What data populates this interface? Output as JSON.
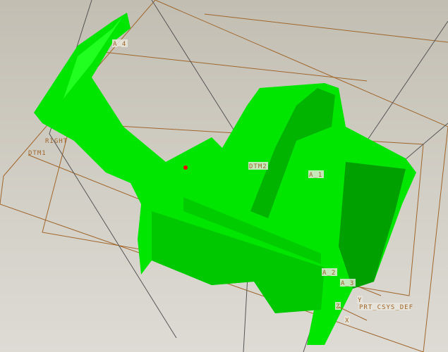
{
  "viewport": {
    "labels": {
      "a4": "A_4",
      "right": "RIGHT",
      "dtm1": "DTM1",
      "dtm2": "DTM2",
      "a1": "A_1",
      "a2": "A_2",
      "a3": "A_3",
      "csys": "PRT_CSYS_DEF",
      "z": "Z",
      "y": "Y",
      "x": "X"
    },
    "colors": {
      "part": "#00ff00",
      "part_shade": "#00c800",
      "datum": "#a0662c",
      "background": "#cfccc2"
    }
  }
}
